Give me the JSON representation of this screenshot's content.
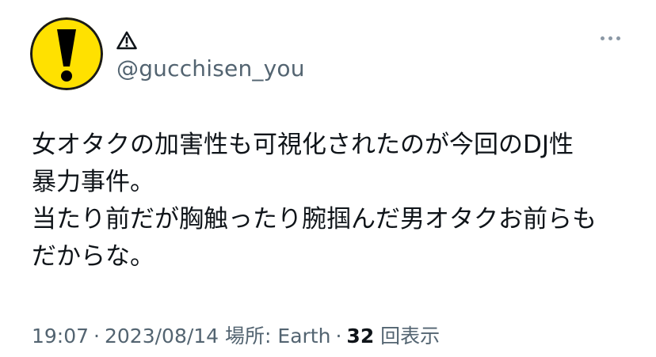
{
  "author": {
    "display_name": "⚠",
    "handle": "@gucchisen_you",
    "avatar_icon": "exclamation-warning-icon",
    "avatar_color": "#ffe100"
  },
  "menu": {
    "icon": "more-options-icon"
  },
  "tweet": {
    "lines": [
      "女オタクの加害性も可視化されたのが今回のDJ性",
      "暴力事件。",
      "当たり前だが胸触ったり腕掴んだ男オタクお前らも",
      "だからな。"
    ]
  },
  "meta": {
    "time": "19:07",
    "separator1": "·",
    "date": "2023/08/14",
    "location": "場所: Earth",
    "separator2": "·",
    "views_count": "32",
    "views_label": "回表示"
  },
  "colors": {
    "text": "#0f1419",
    "secondary": "#536471",
    "avatar_yellow": "#ffe100"
  }
}
